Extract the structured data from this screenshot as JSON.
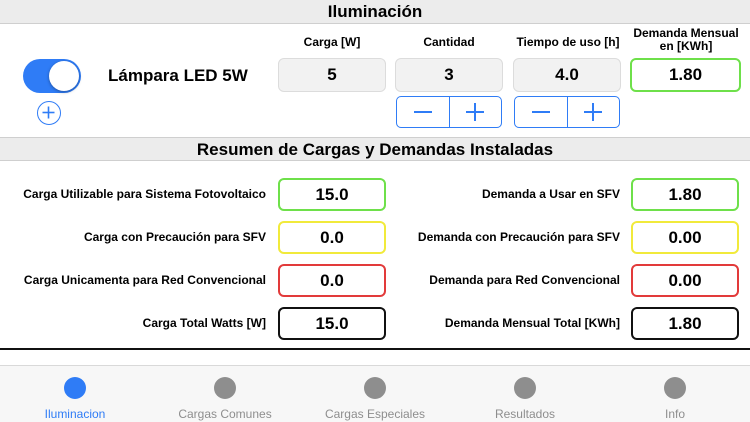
{
  "lighting": {
    "header": "Iluminación",
    "lamp_name": "Lámpara LED 5W",
    "columns": {
      "carga": "Carga [W]",
      "cantidad": "Cantidad",
      "tiempo": "Tiempo de uso [h]",
      "demanda_line1": "Demanda Mensual",
      "demanda_line2": "en [KWh]"
    },
    "values": {
      "carga": "5",
      "cantidad": "3",
      "tiempo": "4.0",
      "demanda": "1.80"
    },
    "toggle_on": true
  },
  "summary": {
    "header": "Resumen de Cargas y Demandas Instaladas",
    "left": [
      {
        "label": "Carga Utilizable para Sistema Fotovoltaico",
        "value": "15.0",
        "color": "#6ee04a"
      },
      {
        "label": "Carga con Precaución para SFV",
        "value": "0.0",
        "color": "#f1ea3b"
      },
      {
        "label": "Carga Unicamenta para Red Convencional",
        "value": "0.0",
        "color": "#e23a3a"
      },
      {
        "label": "Carga Total Watts [W]",
        "value": "15.0",
        "color": "#111111"
      }
    ],
    "right": [
      {
        "label": "Demanda a Usar en SFV",
        "value": "1.80",
        "color": "#6ee04a"
      },
      {
        "label": "Demanda con Precaución para SFV",
        "value": "0.00",
        "color": "#f1ea3b"
      },
      {
        "label": "Demanda para Red Convencional",
        "value": "0.00",
        "color": "#e23a3a"
      },
      {
        "label": "Demanda Mensual Total [KWh]",
        "value": "1.80",
        "color": "#111111"
      }
    ]
  },
  "tabs": [
    {
      "label": "Iluminacion",
      "active": true
    },
    {
      "label": "Cargas Comunes",
      "active": false
    },
    {
      "label": "Cargas Especiales",
      "active": false
    },
    {
      "label": "Resultados",
      "active": false
    },
    {
      "label": "Info",
      "active": false
    }
  ],
  "colors": {
    "accent": "#2f7cf6",
    "inactive_tab": "#8e8e8e"
  }
}
